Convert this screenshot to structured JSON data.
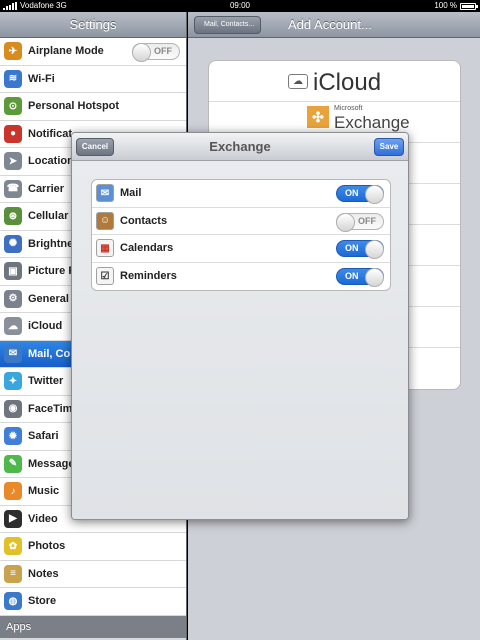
{
  "status_bar": {
    "carrier": "Vodafone 3G",
    "time": "09:00",
    "battery_percent": "100 %",
    "battery_level": 1.0
  },
  "master": {
    "title": "Settings",
    "items": [
      {
        "label": "Airplane Mode",
        "icon": "airplane-icon",
        "color": "#d98c1e",
        "glyph": "✈",
        "toggle": "OFF"
      },
      {
        "label": "Wi-Fi",
        "icon": "wifi-icon",
        "color": "#3a78d0",
        "glyph": "≋"
      },
      {
        "label": "Personal Hotspot",
        "icon": "hotspot-icon",
        "color": "#5d9a3a",
        "glyph": "⊙"
      },
      {
        "label": "Notificat",
        "icon": "notifications-icon",
        "color": "#c9352b",
        "glyph": "●"
      },
      {
        "label": "Location",
        "icon": "location-icon",
        "color": "#7f8792",
        "glyph": "➤"
      },
      {
        "label": "Carrier",
        "icon": "carrier-icon",
        "color": "#7f8792",
        "glyph": "☎"
      },
      {
        "label": "Cellular",
        "icon": "cellular-icon",
        "color": "#5a8f3c",
        "glyph": "⊛"
      },
      {
        "label": "Brightne",
        "icon": "brightness-icon",
        "color": "#3f6fc2",
        "glyph": "✺"
      },
      {
        "label": "Picture F",
        "icon": "picture-frame-icon",
        "color": "#6d7580",
        "glyph": "▣"
      },
      {
        "label": "General",
        "icon": "gear-icon",
        "color": "#7b828d",
        "glyph": "⚙"
      },
      {
        "label": "iCloud",
        "icon": "icloud-icon",
        "color": "#8a9099",
        "glyph": "☁"
      },
      {
        "label": "Mail, Co",
        "icon": "mail-icon",
        "color": "#3a79c8",
        "glyph": "✉",
        "selected": true
      },
      {
        "label": "Twitter",
        "icon": "twitter-icon",
        "color": "#39a6dd",
        "glyph": "✦"
      },
      {
        "label": "FaceTim",
        "icon": "facetime-icon",
        "color": "#6e757f",
        "glyph": "◉"
      },
      {
        "label": "Safari",
        "icon": "safari-icon",
        "color": "#3f80d6",
        "glyph": "✹"
      },
      {
        "label": "Message",
        "icon": "messages-icon",
        "color": "#4fb74c",
        "glyph": "✎"
      },
      {
        "label": "Music",
        "icon": "music-icon",
        "color": "#e9892a",
        "glyph": "♪"
      },
      {
        "label": "Video",
        "icon": "video-icon",
        "color": "#2e2e2e",
        "glyph": "▶"
      },
      {
        "label": "Photos",
        "icon": "photos-icon",
        "color": "#e1c127",
        "glyph": "✿"
      },
      {
        "label": "Notes",
        "icon": "notes-icon",
        "color": "#c9a24d",
        "glyph": "≡"
      },
      {
        "label": "Store",
        "icon": "store-icon",
        "color": "#3a7ac9",
        "glyph": "◍"
      }
    ],
    "group_header": "Apps"
  },
  "detail": {
    "back_label": "Mail, Contacts...",
    "title": "Add Account...",
    "icloud_label": "iCloud",
    "exchange_small": "Microsoft",
    "exchange_label": "Exchange"
  },
  "modal": {
    "title": "Exchange",
    "cancel_label": "Cancel",
    "save_label": "Save",
    "toggles": [
      {
        "label": "Mail",
        "icon": "mail-icon",
        "state": "ON"
      },
      {
        "label": "Contacts",
        "icon": "contacts-icon",
        "state": "OFF"
      },
      {
        "label": "Calendars",
        "icon": "calendar-icon",
        "state": "ON"
      },
      {
        "label": "Reminders",
        "icon": "reminders-icon",
        "state": "ON"
      }
    ]
  },
  "colors": {
    "accent": "#1b6bd7",
    "selected": "#2f86e5"
  }
}
